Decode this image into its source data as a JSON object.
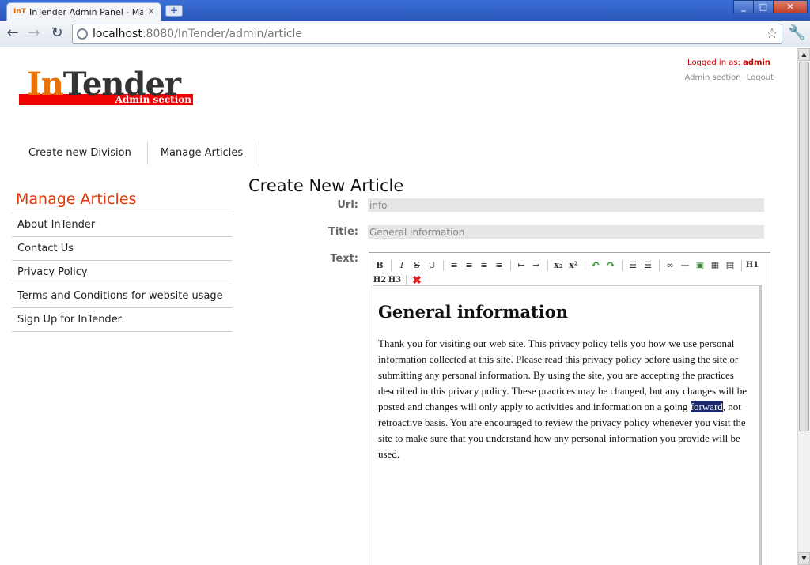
{
  "browser": {
    "tab_title": "InTender Admin Panel - Ma...",
    "tab_favicon": "InT",
    "tab_close": "×",
    "new_tab": "+",
    "url_host": "localhost",
    "url_rest": ":8080/InTender/admin/article",
    "icons": {
      "back": "←",
      "forward": "→",
      "reload": "↻",
      "star": "☆",
      "wrench": "🔧",
      "minimize": "_",
      "maximize": "□",
      "close": "✕"
    }
  },
  "header": {
    "logo_in": "In",
    "logo_tender": "Tender",
    "logo_sub": "Admin section",
    "logged_in_label": "Logged in as:",
    "logged_in_user": "admin",
    "admin_section_link": "Admin section",
    "logout_link": "Logout"
  },
  "topnav": {
    "items": [
      {
        "label": "Create new Division"
      },
      {
        "label": "Manage Articles"
      }
    ]
  },
  "sidebar": {
    "title": "Manage Articles",
    "items": [
      {
        "label": "About InTender"
      },
      {
        "label": "Contact Us"
      },
      {
        "label": "Privacy Policy"
      },
      {
        "label": "Terms and Conditions for website usage"
      },
      {
        "label": "Sign Up for InTender"
      }
    ]
  },
  "form": {
    "title": "Create New Article",
    "url_label": "Url:",
    "url_value": "info",
    "title_label": "Title:",
    "title_value": "General information",
    "text_label": "Text:"
  },
  "editor": {
    "toolbar": {
      "bold": "B",
      "italic": "I",
      "strike": "S",
      "underline": "U",
      "align_left": "≡",
      "align_center": "≡",
      "align_right": "≡",
      "justify": "≡",
      "outdent": "⇤",
      "indent": "⇥",
      "subscript": "x₂",
      "superscript": "x²",
      "undo": "↶",
      "redo": "↷",
      "ordered_list": "☰",
      "unordered_list": "☰",
      "link": "∞",
      "hr": "—",
      "image": "▣",
      "table": "▦",
      "source": "▤",
      "h1": "H1",
      "h2": "H2",
      "h3": "H3",
      "remove_format": "✖"
    },
    "heading": "General information",
    "para_before": "Thank you for visiting our web site. This privacy policy tells you how we use personal information collected at this site. Please read this privacy policy before using the site or submitting any personal information. By using the site, you are accepting the practices described in this privacy policy. These practices may be changed, but any changes will be posted and changes will only apply to activities and information on a going ",
    "para_selected": "forward",
    "para_after": ", not retroactive basis.  You are encouraged to review the privacy policy whenever you visit the site to make sure that you understand how any personal information you provide will be used."
  },
  "scrollbar": {
    "up": "▲",
    "down": "▼"
  }
}
